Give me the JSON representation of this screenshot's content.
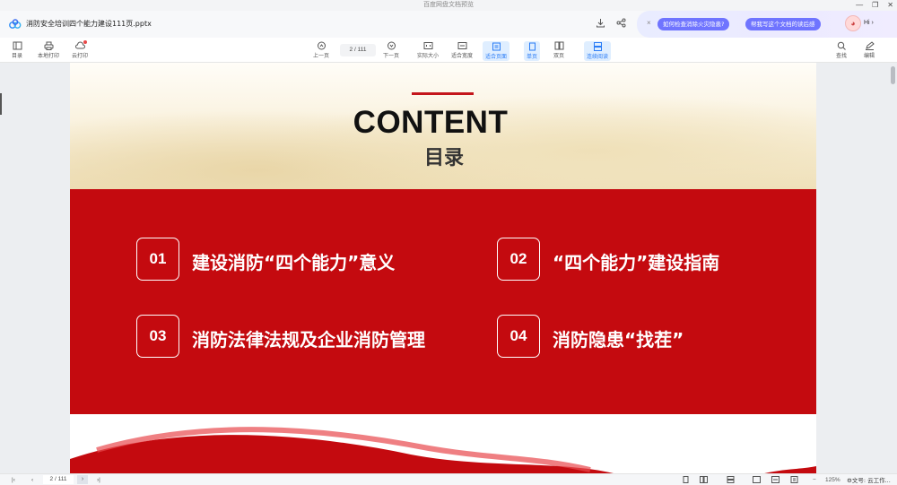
{
  "window": {
    "title": "百度网盘文档预览",
    "controls": [
      "—",
      "❐",
      "✕"
    ]
  },
  "document": {
    "filename": "消防安全培训四个能力建设111页.pptx",
    "actions": [
      "download-icon",
      "share-icon"
    ]
  },
  "ai_panel": {
    "close": "×",
    "chips": [
      "如何检查消除火灾隐患?",
      "帮我写这个文档的读后感"
    ],
    "greeting": "Hi ›"
  },
  "toolbar": {
    "left": [
      {
        "label": "目录",
        "icon": "toc-icon"
      },
      {
        "label": "本地打印",
        "icon": "printer-icon"
      },
      {
        "label": "云打印",
        "icon": "cloud-print-icon"
      }
    ],
    "prev_label": "上一页",
    "page_indicator": "2 / 111",
    "next_label": "下一页",
    "view_modes": [
      {
        "label": "实际大小",
        "icon": "actual-size-icon",
        "active": false
      },
      {
        "label": "适合宽度",
        "icon": "fit-width-icon",
        "active": false
      },
      {
        "label": "适合页面",
        "icon": "fit-page-icon",
        "active": true
      },
      {
        "label": "单页",
        "icon": "single-page-icon",
        "active": true
      },
      {
        "label": "双页",
        "icon": "double-page-icon",
        "active": false
      },
      {
        "label": "连续阅读",
        "icon": "continuous-icon",
        "active": true
      }
    ],
    "right": [
      {
        "label": "查找",
        "icon": "search-icon"
      },
      {
        "label": "编辑",
        "icon": "edit-icon"
      }
    ]
  },
  "slide": {
    "title": "CONTENT",
    "subtitle": "目录",
    "items": [
      {
        "num": "01",
        "label": "建设消防“四个能力”意义"
      },
      {
        "num": "02",
        "label": "“四个能力”建设指南"
      },
      {
        "num": "03",
        "label": "消防法律法规及企业消防管理"
      },
      {
        "num": "04",
        "label": "消防隐患“找茬”"
      }
    ],
    "colors": {
      "red": "#c40a0f",
      "line": "#c4161c"
    }
  },
  "statusbar": {
    "page_indicator": "2 / 111",
    "next": "›",
    "zoom": "125%",
    "tray": "⚙文号: 云工作..."
  }
}
